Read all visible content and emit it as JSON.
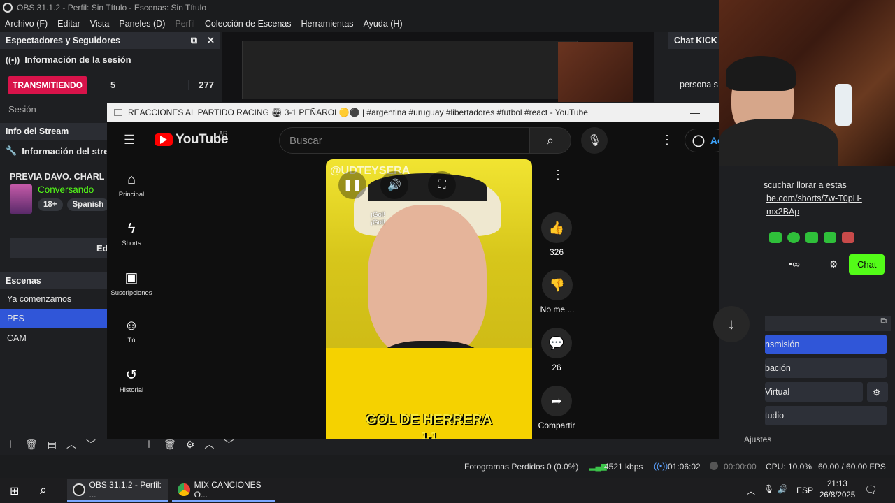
{
  "window": {
    "title": "OBS 31.1.2 - Perfil: Sin Título - Escenas: Sin Título"
  },
  "menu": [
    "Archivo (F)",
    "Editar",
    "Vista",
    "Paneles (D)",
    "Perfil",
    "Colección de Escenas",
    "Herramientas",
    "Ayuda (H)"
  ],
  "viewers_dock": {
    "title": "Espectadores y Seguidores",
    "section": "Información de la sesión",
    "status": "TRANSMITIENDO",
    "viewers": "5",
    "followers": "277",
    "session_label": "Sesión"
  },
  "stream_info_dock": {
    "title": "Info del Stream",
    "section": "Información del stre",
    "stream_title": "PREVIA DAVO. CHARL",
    "category": "Conversando",
    "tags": [
      "18+",
      "Spanish"
    ],
    "edit_label": "Ed"
  },
  "scenes_dock": {
    "title": "Escenas",
    "items": [
      "Ya comenzamos",
      "PES",
      "CAM"
    ],
    "selected": "PES"
  },
  "chat_dock": {
    "title": "Chat KICK",
    "message1": "persona s",
    "message2": "scuchar llorar a estas",
    "link1": "be.com/shorts/7w-T0pH-",
    "link2": "mx2BAp",
    "chat_button": "Chat"
  },
  "controls_dock": {
    "items": [
      "nsmisión",
      "bación",
      "Virtual",
      "tudio",
      "Ajustes"
    ]
  },
  "youtube": {
    "tab_title": "REACCIONES AL PARTIDO RACING 🏟 3-1 PEÑAROL🟡⚫ | #argentina #uruguay #libertadores #futbol #react - YouTube",
    "logo": "YouTube",
    "region": "AR",
    "search_placeholder": "Buscar",
    "account_label": "Ac",
    "nav": [
      {
        "label": "Principal",
        "icon": "home-icon"
      },
      {
        "label": "Shorts",
        "icon": "shorts-icon"
      },
      {
        "label": "Suscripciones",
        "icon": "subscriptions-icon"
      },
      {
        "label": "Tú",
        "icon": "you-icon"
      },
      {
        "label": "Historial",
        "icon": "history-icon"
      }
    ],
    "video": {
      "channel_watermark": "@UDTEYSERA",
      "overlay_text": "¡Gol!\n¡Gol!",
      "caption": "GOL DE HERRERA",
      "caption2": "1-1"
    },
    "actions": {
      "likes": "326",
      "dislike": "No me ...",
      "comments": "26",
      "share": "Compartir"
    }
  },
  "statusbar": {
    "dropped": "Fotogramas Perdidos 0 (0.0%)",
    "bitrate": "4521 kbps",
    "stream_time": "01:06:02",
    "record_time": "00:00:00",
    "cpu": "CPU: 10.0%",
    "fps": "60.00 / 60.00 FPS"
  },
  "taskbar": {
    "app1": "OBS 31.1.2 - Perfil: ...",
    "app2": "MIX CANCIONES O...",
    "lang": "ESP",
    "time": "21:13",
    "date": "26/8/2025"
  },
  "colors": {
    "live": "#d8134a",
    "accent": "#3056d8",
    "kick": "#53fc18"
  }
}
